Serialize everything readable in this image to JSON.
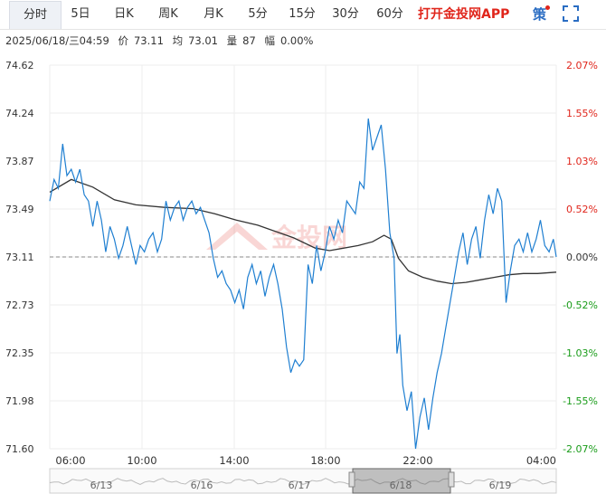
{
  "tabs": [
    "分时",
    "5日",
    "日K",
    "周K",
    "月K",
    "5分",
    "15分",
    "30分",
    "60分"
  ],
  "active_tab": 0,
  "promo_label": "打开金投网APP",
  "strategy_label": "策",
  "info": {
    "datetime": "2025/06/18/三04:59",
    "price_label": "价",
    "price": "73.11",
    "avg_label": "均",
    "avg": "73.01",
    "vol_label": "量",
    "vol": "87",
    "chg_label": "幅",
    "chg": "0.00%"
  },
  "watermark": "金投网",
  "colors": {
    "price_line": "#1f7fd1",
    "avg_line": "#333333",
    "up": "#e0251b",
    "down": "#1a9c1a",
    "accent": "#2a6dc3"
  },
  "chart_data": {
    "type": "line",
    "y_ticks_left": [
      "74.62",
      "74.24",
      "73.87",
      "73.49",
      "73.11",
      "72.73",
      "72.35",
      "71.98",
      "71.60"
    ],
    "y_ticks_right": [
      "2.07%",
      "1.55%",
      "1.03%",
      "0.52%",
      "0.00%",
      "-0.52%",
      "-1.03%",
      "-1.55%",
      "-2.07%"
    ],
    "x_ticks": [
      "06:00",
      "10:00",
      "14:00",
      "18:00",
      "22:00",
      "04:00"
    ],
    "ylim": [
      71.6,
      74.62
    ],
    "reference_price": 73.11,
    "x_hours": [
      0,
      1,
      2,
      3,
      4,
      5,
      6,
      7,
      8,
      9,
      10,
      11,
      12,
      13,
      14,
      15,
      16,
      17,
      18,
      19,
      20,
      21,
      22,
      23
    ],
    "price": [
      [
        0.0,
        73.55
      ],
      [
        0.3,
        73.72
      ],
      [
        0.6,
        73.65
      ],
      [
        0.9,
        74.0
      ],
      [
        1.2,
        73.75
      ],
      [
        1.5,
        73.8
      ],
      [
        1.8,
        73.7
      ],
      [
        2.1,
        73.8
      ],
      [
        2.4,
        73.6
      ],
      [
        2.7,
        73.55
      ],
      [
        3.0,
        73.35
      ],
      [
        3.3,
        73.55
      ],
      [
        3.6,
        73.4
      ],
      [
        3.9,
        73.15
      ],
      [
        4.2,
        73.35
      ],
      [
        4.5,
        73.25
      ],
      [
        4.8,
        73.1
      ],
      [
        5.1,
        73.2
      ],
      [
        5.4,
        73.35
      ],
      [
        5.7,
        73.2
      ],
      [
        6.0,
        73.05
      ],
      [
        6.3,
        73.2
      ],
      [
        6.6,
        73.15
      ],
      [
        6.9,
        73.25
      ],
      [
        7.2,
        73.3
      ],
      [
        7.5,
        73.15
      ],
      [
        7.8,
        73.25
      ],
      [
        8.1,
        73.55
      ],
      [
        8.4,
        73.4
      ],
      [
        8.7,
        73.5
      ],
      [
        9.0,
        73.55
      ],
      [
        9.3,
        73.4
      ],
      [
        9.6,
        73.5
      ],
      [
        9.9,
        73.55
      ],
      [
        10.2,
        73.45
      ],
      [
        10.5,
        73.5
      ],
      [
        10.8,
        73.4
      ],
      [
        11.1,
        73.3
      ],
      [
        11.4,
        73.1
      ],
      [
        11.7,
        72.95
      ],
      [
        12.0,
        73.0
      ],
      [
        12.3,
        72.9
      ],
      [
        12.6,
        72.85
      ],
      [
        12.9,
        72.75
      ],
      [
        13.2,
        72.85
      ],
      [
        13.5,
        72.7
      ],
      [
        13.8,
        72.95
      ],
      [
        14.1,
        73.05
      ],
      [
        14.4,
        72.9
      ],
      [
        14.7,
        73.0
      ],
      [
        15.0,
        72.8
      ],
      [
        15.3,
        72.95
      ],
      [
        15.6,
        73.05
      ],
      [
        15.9,
        72.9
      ],
      [
        16.2,
        72.7
      ],
      [
        16.5,
        72.4
      ],
      [
        16.8,
        72.2
      ],
      [
        17.1,
        72.3
      ],
      [
        17.4,
        72.25
      ],
      [
        17.7,
        72.3
      ],
      [
        18.0,
        73.05
      ],
      [
        18.3,
        72.9
      ],
      [
        18.6,
        73.2
      ],
      [
        18.9,
        73.0
      ],
      [
        19.2,
        73.15
      ],
      [
        19.5,
        73.35
      ],
      [
        19.8,
        73.25
      ],
      [
        20.1,
        73.4
      ],
      [
        20.4,
        73.3
      ],
      [
        20.7,
        73.55
      ],
      [
        21.0,
        73.5
      ],
      [
        21.3,
        73.45
      ],
      [
        21.6,
        73.7
      ],
      [
        21.9,
        73.65
      ],
      [
        22.2,
        74.2
      ],
      [
        22.5,
        73.95
      ],
      [
        22.8,
        74.05
      ],
      [
        23.1,
        74.15
      ],
      [
        23.4,
        73.8
      ],
      [
        23.7,
        73.3
      ],
      [
        24.0,
        73.1
      ],
      [
        24.2,
        72.35
      ],
      [
        24.4,
        72.5
      ],
      [
        24.6,
        72.1
      ],
      [
        24.9,
        71.9
      ],
      [
        25.2,
        72.05
      ],
      [
        25.5,
        71.6
      ],
      [
        25.8,
        71.85
      ],
      [
        26.1,
        72.0
      ],
      [
        26.4,
        71.75
      ],
      [
        26.7,
        72.0
      ],
      [
        27.0,
        72.2
      ],
      [
        27.3,
        72.35
      ],
      [
        27.6,
        72.55
      ],
      [
        27.9,
        72.75
      ],
      [
        28.2,
        72.95
      ],
      [
        28.5,
        73.15
      ],
      [
        28.8,
        73.3
      ],
      [
        29.1,
        73.05
      ],
      [
        29.4,
        73.25
      ],
      [
        29.7,
        73.35
      ],
      [
        30.0,
        73.1
      ],
      [
        30.3,
        73.4
      ],
      [
        30.6,
        73.6
      ],
      [
        30.9,
        73.45
      ],
      [
        31.2,
        73.65
      ],
      [
        31.5,
        73.55
      ],
      [
        31.8,
        72.75
      ],
      [
        32.1,
        73.0
      ],
      [
        32.4,
        73.2
      ],
      [
        32.7,
        73.25
      ],
      [
        33.0,
        73.15
      ],
      [
        33.3,
        73.3
      ],
      [
        33.6,
        73.15
      ],
      [
        33.9,
        73.25
      ],
      [
        34.2,
        73.4
      ],
      [
        34.5,
        73.2
      ],
      [
        34.8,
        73.15
      ],
      [
        35.1,
        73.25
      ],
      [
        35.3,
        73.11
      ]
    ],
    "avg": [
      [
        0.0,
        73.62
      ],
      [
        1.5,
        73.72
      ],
      [
        3.0,
        73.66
      ],
      [
        4.5,
        73.56
      ],
      [
        6.0,
        73.52
      ],
      [
        8.0,
        73.5
      ],
      [
        10.0,
        73.49
      ],
      [
        11.5,
        73.45
      ],
      [
        13.0,
        73.4
      ],
      [
        14.5,
        73.36
      ],
      [
        16.0,
        73.3
      ],
      [
        17.0,
        73.26
      ],
      [
        18.5,
        73.18
      ],
      [
        19.5,
        73.16
      ],
      [
        20.5,
        73.18
      ],
      [
        21.5,
        73.2
      ],
      [
        22.5,
        73.23
      ],
      [
        23.3,
        73.28
      ],
      [
        23.8,
        73.25
      ],
      [
        24.3,
        73.1
      ],
      [
        25.0,
        73.0
      ],
      [
        26.0,
        72.95
      ],
      [
        27.0,
        72.92
      ],
      [
        28.0,
        72.9
      ],
      [
        29.0,
        72.91
      ],
      [
        30.0,
        72.93
      ],
      [
        31.0,
        72.95
      ],
      [
        32.0,
        72.97
      ],
      [
        33.0,
        72.98
      ],
      [
        34.0,
        72.98
      ],
      [
        35.3,
        72.99
      ]
    ]
  },
  "navigator": {
    "dates": [
      "6/13",
      "6/16",
      "6/17",
      "6/18",
      "6/19"
    ]
  }
}
